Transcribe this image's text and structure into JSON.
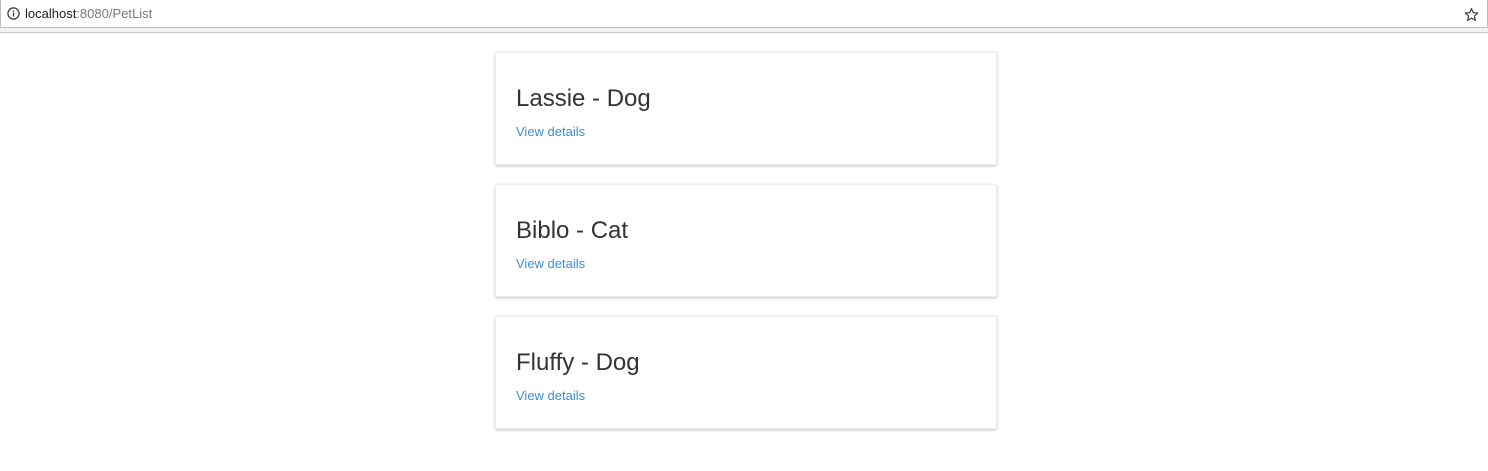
{
  "browser": {
    "url_host": "localhost",
    "url_path": ":8080/PetList",
    "info_icon": "info-circle-icon",
    "bookmark_icon": "star-outline-icon"
  },
  "pets": [
    {
      "title": "Lassie - Dog",
      "link_label": "View details"
    },
    {
      "title": "Biblo - Cat",
      "link_label": "View details"
    },
    {
      "title": "Fluffy - Dog",
      "link_label": "View details"
    }
  ],
  "colors": {
    "link": "#3b8fd6",
    "title": "#333333"
  }
}
